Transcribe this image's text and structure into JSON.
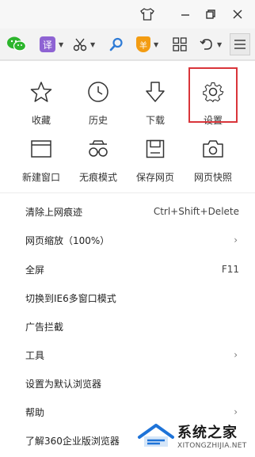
{
  "titlebar": {
    "skin_icon": "tshirt-icon",
    "minimize_icon": "minimize-icon",
    "restore_icon": "restore-icon",
    "close_icon": "close-icon"
  },
  "toolbar": {
    "wechat_icon": "wechat-icon",
    "translate_label": "译",
    "translate_icon": "translate-icon",
    "scissors_icon": "scissors-icon",
    "search_icon": "search-icon",
    "shield_label": "羊",
    "shield_icon": "shield-icon",
    "apps_icon": "apps-grid-icon",
    "undo_icon": "undo-icon",
    "menu_icon": "hamburger-menu-icon",
    "accent_green": "#2cb52c",
    "accent_purple": "#8e63d3",
    "accent_blue": "#2e7bd6",
    "accent_orange": "#f39c12"
  },
  "menu": {
    "grid_row1": [
      {
        "label": "收藏",
        "icon": "star-icon"
      },
      {
        "label": "历史",
        "icon": "clock-icon"
      },
      {
        "label": "下载",
        "icon": "download-icon"
      },
      {
        "label": "设置",
        "icon": "settings-gear-icon"
      }
    ],
    "grid_row2": [
      {
        "label": "新建窗口",
        "icon": "new-window-icon"
      },
      {
        "label": "无痕模式",
        "icon": "incognito-icon"
      },
      {
        "label": "保存网页",
        "icon": "save-icon"
      },
      {
        "label": "网页快照",
        "icon": "camera-icon"
      }
    ],
    "highlight_color": "#d9353a",
    "items": [
      {
        "label": "清除上网痕迹",
        "shortcut": "Ctrl+Shift+Delete",
        "arrow": ""
      },
      {
        "label": "网页缩放（100%）",
        "shortcut": "",
        "arrow": "›"
      },
      {
        "label": "全屏",
        "shortcut": "F11",
        "arrow": ""
      },
      {
        "label": "切换到IE6多窗口模式",
        "shortcut": "",
        "arrow": ""
      },
      {
        "label": "广告拦截",
        "shortcut": "",
        "arrow": ""
      },
      {
        "label": "工具",
        "shortcut": "",
        "arrow": "›"
      },
      {
        "label": "设置为默认浏览器",
        "shortcut": "",
        "arrow": ""
      },
      {
        "label": "帮助",
        "shortcut": "",
        "arrow": "›"
      },
      {
        "label": "了解360企业版浏览器",
        "shortcut": "",
        "arrow": ""
      }
    ]
  },
  "watermark": {
    "main": "系统之家",
    "sub": "XITONGZHIJIA.NET"
  }
}
